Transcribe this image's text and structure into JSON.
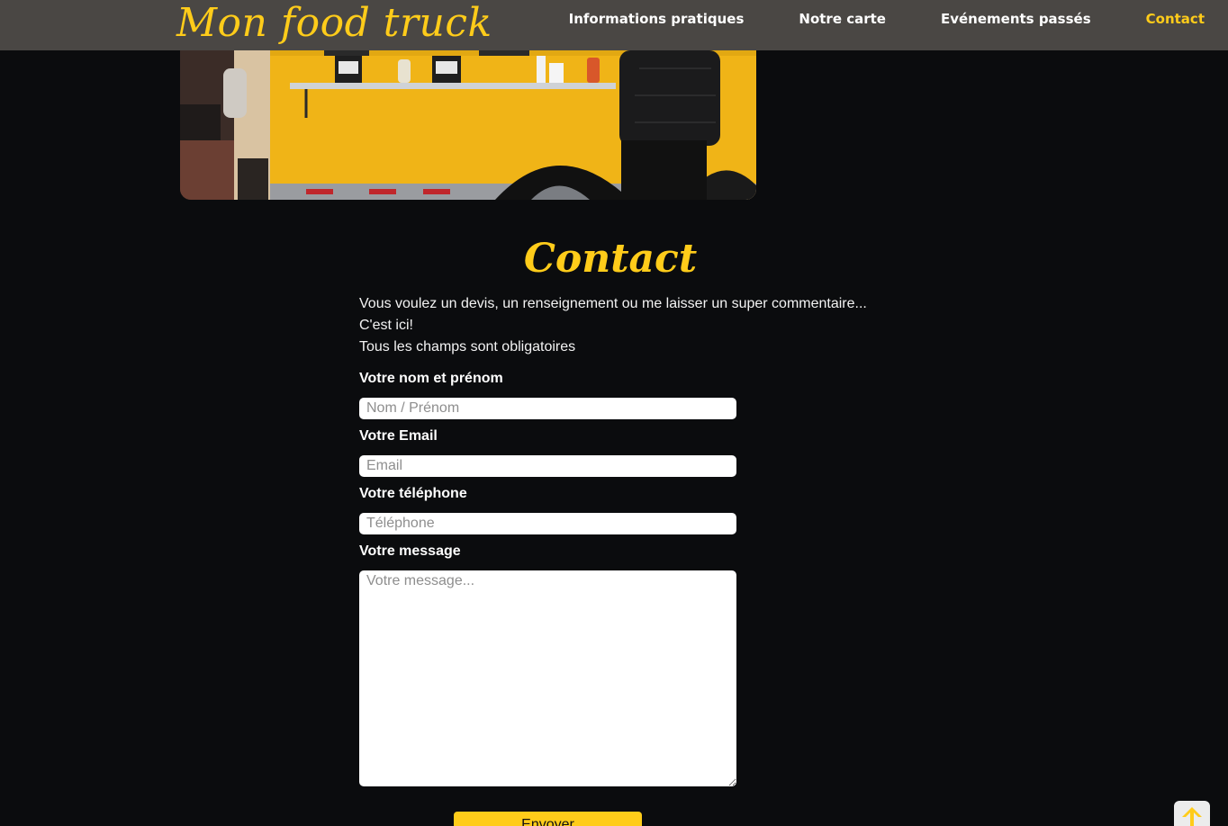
{
  "header": {
    "logo": "Mon food truck",
    "nav": [
      {
        "label": "Informations pratiques",
        "active": false
      },
      {
        "label": "Notre carte",
        "active": false
      },
      {
        "label": "Evénements passés",
        "active": false
      },
      {
        "label": "Contact",
        "active": true
      }
    ]
  },
  "hero": {
    "icon": "food-truck-photo"
  },
  "contact": {
    "title": "Contact",
    "intro": [
      "Vous voulez un devis, un renseignement ou me laisser un super commentaire...",
      "C'est ici!",
      "Tous les champs sont obligatoires"
    ],
    "fields": {
      "name": {
        "label": "Votre nom et prénom",
        "placeholder": "Nom / Prénom",
        "value": ""
      },
      "email": {
        "label": "Votre Email",
        "placeholder": "Email",
        "value": ""
      },
      "phone": {
        "label": "Votre téléphone",
        "placeholder": "Téléphone",
        "value": ""
      },
      "message": {
        "label": "Votre message",
        "placeholder": "Votre message...",
        "value": ""
      }
    },
    "submit_label": "Envoyer"
  },
  "back_to_top": {
    "icon": "arrow-up-icon"
  },
  "colors": {
    "accent": "#ffcc1a",
    "header_bg": "#4a4744",
    "page_bg": "#0b0c0e"
  }
}
